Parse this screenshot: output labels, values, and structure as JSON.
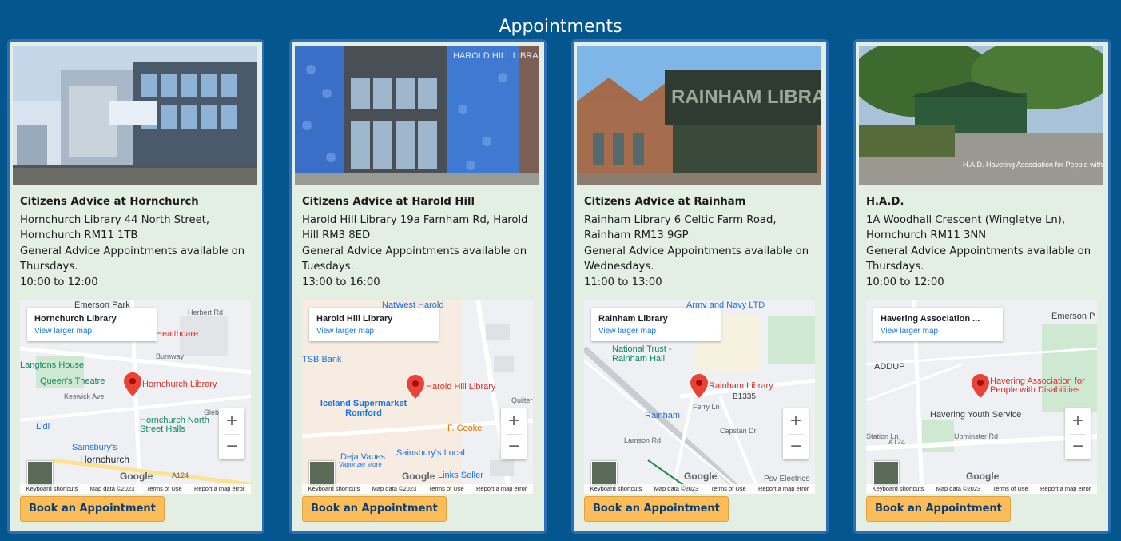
{
  "page_title": "Appointments",
  "colors": {
    "background": "#04578e",
    "card": "#e4efe4",
    "card_border": "#2f6db4",
    "button": "#fbbc5a",
    "button_text": "#0a3d73"
  },
  "cards": [
    {
      "name": "Citizens Advice at Hornchurch",
      "address": "Hornchurch Library 44 North Street, Hornchurch RM11 1TB",
      "availability": "General Advice Appointments available on Thursdays.",
      "time": "10:00 to 12:00",
      "photo_caption": "",
      "map": {
        "title": "Hornchurch Library",
        "link": "View larger map",
        "pin_label": "Hornchurch Library",
        "labels": [
          "Emerson Park",
          "Herbert Rd",
          "Healthcare",
          "Burnway",
          "Langtons House",
          "Queen's Theatre",
          "Keswick Ave",
          "Glebe Way",
          "Hornchurch North Street Halls",
          "Lidl",
          "Sainsbury's",
          "Hornchurch",
          "A124"
        ]
      },
      "button": "Book an Appointment"
    },
    {
      "name": "Citizens Advice at Harold Hill",
      "address": "Harold Hill Library 19a Farnham Rd, Harold Hill RM3 8ED",
      "availability": "General Advice Appointments available on Tuesdays.",
      "time": "13:00 to 16:00",
      "photo_caption": "HAROLD HILL LIBRARY",
      "map": {
        "title": "Harold Hill Library",
        "link": "View larger map",
        "pin_label": "Harold Hill Library",
        "labels": [
          "NatWest Harold",
          "TSB Bank",
          "Iceland Supermarket Romford",
          "F. Cooke",
          "Deja Vapes",
          "Vaporizer store",
          "Sainsbury's Local",
          "Links Seller",
          "Quilter Wy"
        ]
      },
      "button": "Book an Appointment"
    },
    {
      "name": "Citizens Advice at Rainham",
      "address": "Rainham Library 6 Celtic Farm Road, Rainham RM13 9GP",
      "availability": "General Advice Appointments available on Wednesdays.",
      "time": "11:00 to 13:00",
      "photo_caption": "RAINHAM LIBRARY",
      "map": {
        "title": "Rainham Library",
        "link": "View larger map",
        "pin_label": "Rainham Library",
        "labels": [
          "Army and Navy LTD",
          "National Trust - Rainham Hall",
          "B1335",
          "Rainham",
          "Ferry Ln",
          "Capstan Dr",
          "Lamson Rd",
          "Psv Electrics"
        ]
      },
      "button": "Book an Appointment"
    },
    {
      "name": "H.A.D.",
      "address": "1A Woodhall Crescent (Wingletye Ln), Hornchurch RM11 3NN",
      "availability": "General Advice Appointments available on Thursdays.",
      "time": "10:00 to 12:00",
      "photo_caption": "H.A.D. Havering Association for People with Disabilities",
      "map": {
        "title": "Havering Association ...",
        "link": "View larger map",
        "pin_label": "Havering Association for People with Disabilities",
        "labels": [
          "Emerson P",
          "ADDUP",
          "Havering Youth Service",
          "A124",
          "Upminster Rd",
          "Station Ln"
        ]
      },
      "button": "Book an Appointment"
    }
  ],
  "map_footer": {
    "shortcuts": "Keyboard shortcuts",
    "data": "Map data ©2023",
    "terms": "Terms of Use",
    "report": "Report a map error"
  },
  "map_brand": "Google",
  "icons": {
    "pin": "map-pin-icon",
    "zoom_in": "plus",
    "zoom_out": "minus"
  }
}
